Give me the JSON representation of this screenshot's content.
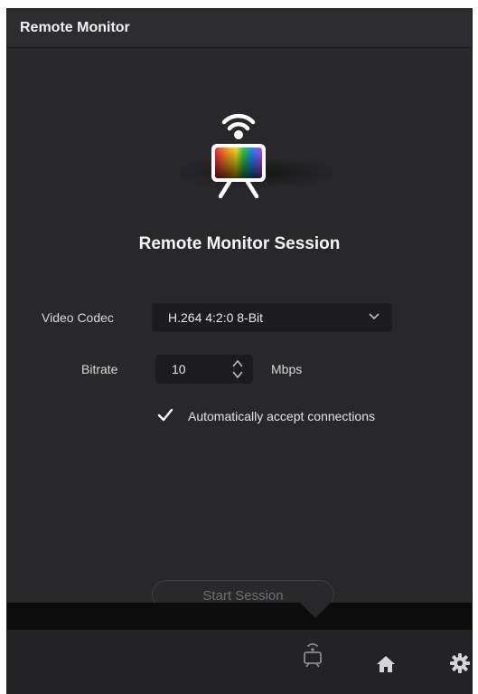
{
  "window": {
    "title": "Remote Monitor"
  },
  "session": {
    "title": "Remote Monitor Session",
    "video_codec_label": "Video Codec",
    "video_codec_value": "H.264 4:2:0 8-Bit",
    "bitrate_label": "Bitrate",
    "bitrate_value": "10",
    "bitrate_unit": "Mbps",
    "auto_accept_label": "Automatically accept connections",
    "auto_accept_checked": true,
    "start_label": "Start Session"
  },
  "icons": {
    "hero": "remote-monitor-icon",
    "toolbar": [
      "remote-monitor-icon",
      "home-icon",
      "gear-icon"
    ]
  },
  "colors": {
    "background": "#28282a",
    "text": "#e8e8e8",
    "disabled_text": "#6e6e72"
  }
}
